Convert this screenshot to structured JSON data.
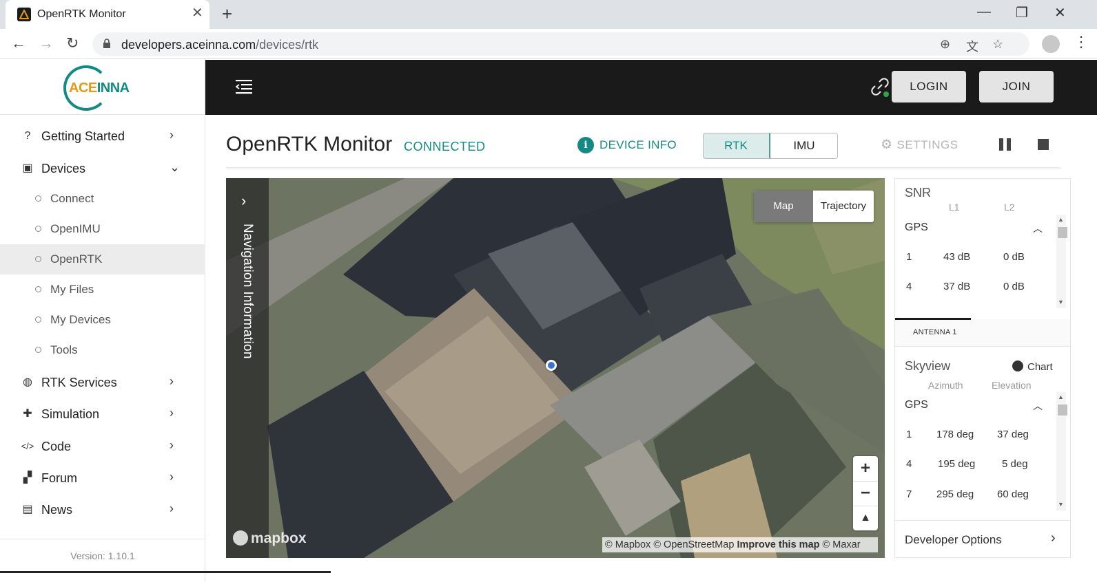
{
  "browser": {
    "tab_title": "OpenRTK Monitor",
    "url_host": "developers.aceinna.com",
    "url_path": "/devices/rtk"
  },
  "logo": {
    "first": "ACE",
    "rest": "INNA"
  },
  "sidebar": {
    "items": [
      {
        "label": "Getting Started",
        "icon": "help-circle-icon",
        "expanded": false
      },
      {
        "label": "Devices",
        "icon": "chip-icon",
        "expanded": true
      },
      {
        "label": "RTK Services",
        "icon": "globe-icon",
        "expanded": false
      },
      {
        "label": "Simulation",
        "icon": "puzzle-icon",
        "expanded": false
      },
      {
        "label": "Code",
        "icon": "code-icon",
        "expanded": false
      },
      {
        "label": "Forum",
        "icon": "forum-icon",
        "expanded": false
      },
      {
        "label": "News",
        "icon": "news-icon",
        "expanded": false
      }
    ],
    "sub_items": [
      {
        "label": "Connect",
        "active": false
      },
      {
        "label": "OpenIMU",
        "active": false
      },
      {
        "label": "OpenRTK",
        "active": true
      },
      {
        "label": "My Files",
        "active": false
      },
      {
        "label": "My Devices",
        "active": false
      },
      {
        "label": "Tools",
        "active": false
      }
    ],
    "version": "Version: 1.10.1"
  },
  "topbar": {
    "login_label": "LOGIN",
    "join_label": "JOIN",
    "link_status_color": "#2ea44f"
  },
  "main": {
    "title": "OpenRTK Monitor",
    "status": "CONNECTED",
    "device_info_label": "DEVICE INFO",
    "modes": [
      "RTK",
      "IMU"
    ],
    "active_mode": "RTK",
    "settings_label": "SETTINGS"
  },
  "map": {
    "nav_info_label": "Navigation Information",
    "toggle_map": "Map",
    "toggle_trajectory": "Trajectory",
    "logo_text": "mapbox",
    "attribution_a": "© Mapbox © OpenStreetMap",
    "attribution_improve": "Improve this map",
    "attribution_b": "© Maxar"
  },
  "snr": {
    "title": "SNR",
    "col_l1": "L1",
    "col_l2": "L2",
    "section": "GPS",
    "rows": [
      {
        "id": "1",
        "l1": "43 dB",
        "l2": "0 dB"
      },
      {
        "id": "4",
        "l1": "37 dB",
        "l2": "0 dB"
      }
    ]
  },
  "antenna_tab": "ANTENNA 1",
  "skyview": {
    "title": "Skyview",
    "chart_label": "Chart",
    "col_azimuth": "Azimuth",
    "col_elevation": "Elevation",
    "section": "GPS",
    "rows": [
      {
        "id": "1",
        "az": "178 deg",
        "el": "37 deg"
      },
      {
        "id": "4",
        "az": "195 deg",
        "el": "5 deg"
      },
      {
        "id": "7",
        "az": "295 deg",
        "el": "60 deg"
      }
    ]
  },
  "developer_options": "Developer Options",
  "colors": {
    "accent": "#138b84",
    "brand_orange": "#e39a1b",
    "topbar": "#1a1a1a"
  }
}
